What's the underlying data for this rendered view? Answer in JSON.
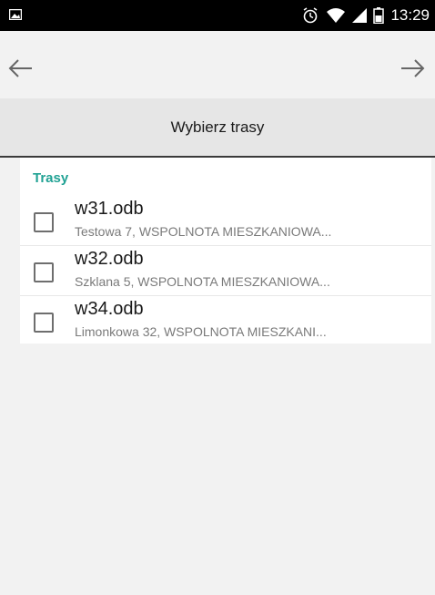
{
  "status_bar": {
    "time": "13:29",
    "icons": [
      "image-icon",
      "alarm-clock-icon",
      "wifi-icon",
      "signal-icon",
      "battery-icon"
    ]
  },
  "toolbar": {
    "back_icon": "arrow-left-icon",
    "forward_icon": "arrow-right-icon"
  },
  "header": {
    "title": "Wybierz trasy"
  },
  "section": {
    "label": "Trasy"
  },
  "routes": [
    {
      "name": "w31.odb",
      "description": "Testowa 7, WSPOLNOTA MIESZKANIOWA...",
      "checked": false
    },
    {
      "name": "w32.odb",
      "description": "Szklana 5, WSPOLNOTA MIESZKANIOWA...",
      "checked": false
    },
    {
      "name": "w34.odb",
      "description": "Limonkowa 32, WSPOLNOTA MIESZKANI...",
      "checked": false
    }
  ],
  "colors": {
    "accent": "#21a294",
    "status_bar": "#000000",
    "header_band": "#e6e6e6",
    "background": "#f2f2f2"
  }
}
